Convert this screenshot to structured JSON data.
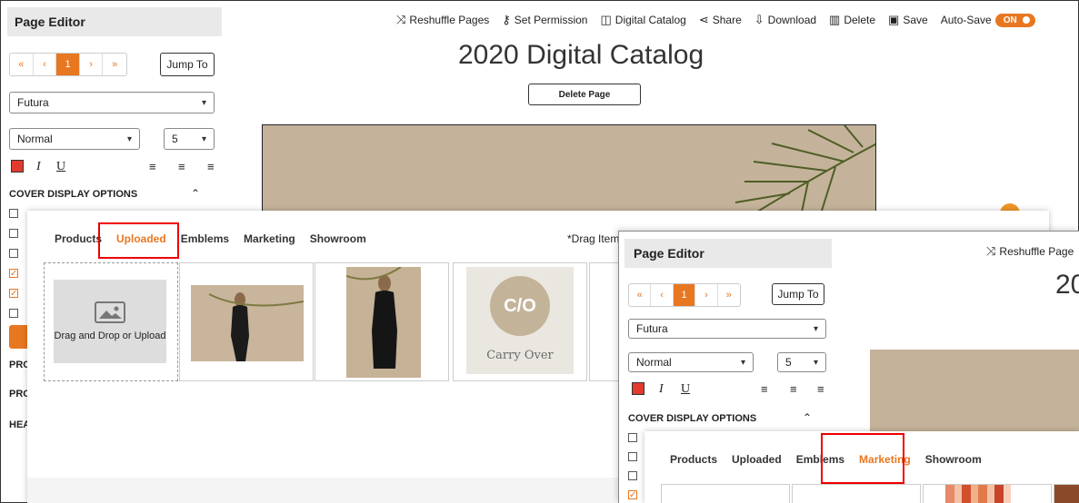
{
  "editor": {
    "title": "Page Editor",
    "pager": {
      "first": "«",
      "prev": "‹",
      "current": "1",
      "next": "›",
      "last": "»",
      "jump_label": "Jump To"
    },
    "font_select": "Futura",
    "style_select": "Normal",
    "size_select": "5",
    "format": {
      "italic": "I",
      "underline": "U"
    },
    "cover_options_title": "COVER DISPLAY OPTIONS",
    "side_labels": [
      "PRO",
      "PRO",
      "HEA"
    ]
  },
  "toolbar": [
    {
      "icon": "shuffle-icon",
      "glyph": "⤨",
      "label": "Reshuffle Pages"
    },
    {
      "icon": "key-icon",
      "glyph": "⚷",
      "label": "Set Permission"
    },
    {
      "icon": "book-icon",
      "glyph": "📖",
      "label": "Digital Catalog"
    },
    {
      "icon": "share-icon",
      "glyph": "⋖",
      "label": "Share"
    },
    {
      "icon": "download-icon",
      "glyph": "⇩",
      "label": "Download"
    },
    {
      "icon": "trash-icon",
      "glyph": "🗑",
      "label": "Delete"
    },
    {
      "icon": "save-icon",
      "glyph": "💾",
      "label": "Save"
    }
  ],
  "autosave": {
    "label": "Auto-Save",
    "state": "ON"
  },
  "catalog_title": "2020 Digital Catalog",
  "delete_page_label": "Delete Page",
  "modal1": {
    "tabs": [
      "Products",
      "Uploaded",
      "Emblems",
      "Marketing",
      "Showroom"
    ],
    "active_tab": "Uploaded",
    "hint": "*Drag Items",
    "drop_label": "Drag and Drop or Upload",
    "carry_over_mark": "C/O",
    "carry_over_label": "Carry Over"
  },
  "overlay": {
    "title": "Page Editor",
    "toolbar_partial": "Reshuffle Page",
    "title_partial": "20",
    "pager": {
      "first": "«",
      "prev": "‹",
      "current": "1",
      "next": "›",
      "last": "»",
      "jump_label": "Jump To"
    },
    "font_select": "Futura",
    "style_select": "Normal",
    "size_select": "5",
    "cover_options_title": "COVER DISPLAY OPTIONS",
    "tabs": [
      "Products",
      "Uploaded",
      "Emblems",
      "Marketing",
      "Showroom"
    ],
    "active_tab": "Marketing"
  },
  "colors": {
    "accent": "#e87722",
    "highlight": "#ee0000"
  }
}
